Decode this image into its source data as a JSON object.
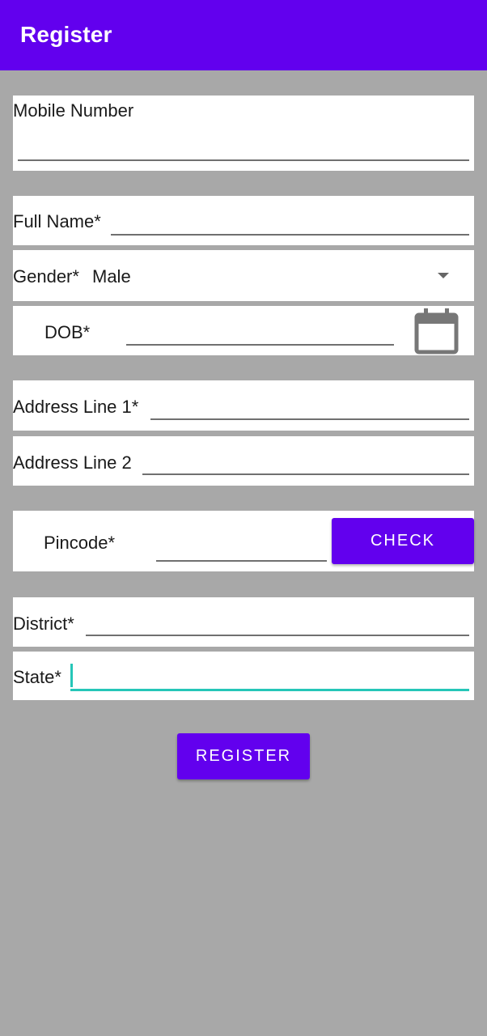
{
  "appbar": {
    "title": "Register"
  },
  "form": {
    "mobile_label": "Mobile Number",
    "mobile_value": "",
    "full_name_label": "Full Name*",
    "full_name_value": "",
    "gender_label": "Gender*",
    "gender_selected": "Male",
    "dob_label": "DOB*",
    "dob_value": "",
    "dob_icon": "calendar-icon",
    "address1_label": "Address Line 1*",
    "address1_value": "",
    "address2_label": "Address Line 2",
    "address2_value": "",
    "pincode_label": "Pincode*",
    "pincode_value": "",
    "check_button": "CHECK",
    "district_label": "District*",
    "district_value": "",
    "state_label": "State*",
    "state_value": "",
    "register_button": "REGISTER"
  },
  "colors": {
    "primary": "#6200ee",
    "background": "#a8a8a8",
    "focus": "#26c6b8",
    "icon": "#777777"
  }
}
